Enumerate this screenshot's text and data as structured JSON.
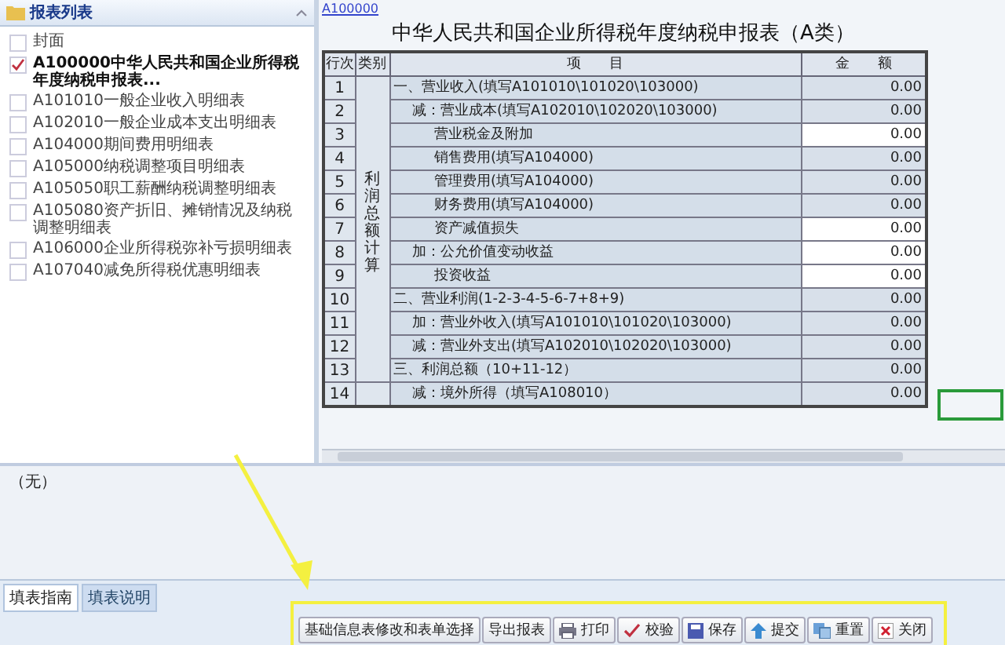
{
  "sidebar": {
    "title": "报表列表",
    "items": [
      {
        "label": "封面",
        "checked": false,
        "selected": false
      },
      {
        "label": "A100000中华人民共和国企业所得税年度纳税申报表...",
        "checked": true,
        "selected": true
      },
      {
        "label": "A101010一般企业收入明细表",
        "checked": false,
        "selected": false
      },
      {
        "label": "A102010一般企业成本支出明细表",
        "checked": false,
        "selected": false
      },
      {
        "label": "A104000期间费用明细表",
        "checked": false,
        "selected": false
      },
      {
        "label": "A105000纳税调整项目明细表",
        "checked": false,
        "selected": false
      },
      {
        "label": "A105050职工薪酬纳税调整明细表",
        "checked": false,
        "selected": false
      },
      {
        "label": "A105080资产折旧、摊销情况及纳税调整明细表",
        "checked": false,
        "selected": false
      },
      {
        "label": "A106000企业所得税弥补亏损明细表",
        "checked": false,
        "selected": false
      },
      {
        "label": "A107040减免所得税优惠明细表",
        "checked": false,
        "selected": false
      }
    ]
  },
  "form": {
    "link": "A100000",
    "title": "中华人民共和国企业所得税年度纳税申报表（A类）",
    "columns": [
      "行次",
      "类别",
      "项　　目",
      "金　　额"
    ],
    "category": "利润总额计算",
    "rows": [
      {
        "no": "1",
        "kind": "head",
        "item": "一、营业收入(填写A101010\\101020\\103000)",
        "amount": "0.00",
        "editable": false
      },
      {
        "no": "2",
        "kind": "sub",
        "item": "减：营业成本(填写A102010\\102020\\103000)",
        "amount": "0.00",
        "editable": false
      },
      {
        "no": "3",
        "kind": "detail",
        "item": "营业税金及附加",
        "amount": "0.00",
        "editable": true
      },
      {
        "no": "4",
        "kind": "detail",
        "item": "销售费用(填写A104000)",
        "amount": "0.00",
        "editable": false
      },
      {
        "no": "5",
        "kind": "detail",
        "item": "管理费用(填写A104000)",
        "amount": "0.00",
        "editable": false
      },
      {
        "no": "6",
        "kind": "detail",
        "item": "财务费用(填写A104000)",
        "amount": "0.00",
        "editable": false
      },
      {
        "no": "7",
        "kind": "detail",
        "item": "资产减值损失",
        "amount": "0.00",
        "editable": true
      },
      {
        "no": "8",
        "kind": "sub",
        "item": "加：公允价值变动收益",
        "amount": "0.00",
        "editable": true
      },
      {
        "no": "9",
        "kind": "detail",
        "item": "投资收益",
        "amount": "0.00",
        "editable": true
      },
      {
        "no": "10",
        "kind": "head",
        "item": "二、营业利润(1-2-3-4-5-6-7+8+9)",
        "amount": "0.00",
        "editable": false
      },
      {
        "no": "11",
        "kind": "sub",
        "item": "加：营业外收入(填写A101010\\101020\\103000)",
        "amount": "0.00",
        "editable": false
      },
      {
        "no": "12",
        "kind": "sub",
        "item": "减：营业外支出(填写A102010\\102020\\103000)",
        "amount": "0.00",
        "editable": false
      },
      {
        "no": "13",
        "kind": "head",
        "item": "三、利润总额（10+11-12）",
        "amount": "0.00",
        "editable": false
      },
      {
        "no": "14",
        "kind": "sub",
        "item": "减：境外所得（填写A108010）",
        "amount": "0.00",
        "editable": false
      }
    ]
  },
  "note": "（无）",
  "tabs": [
    {
      "label": "填表指南",
      "selected": true
    },
    {
      "label": "填表说明",
      "selected": false
    }
  ],
  "buttons": [
    {
      "label": "基础信息表修改和表单选择",
      "kind": "plain"
    },
    {
      "label": "导出报表",
      "kind": "plain"
    },
    {
      "label": "打印",
      "kind": "print"
    },
    {
      "label": "校验",
      "kind": "check"
    },
    {
      "label": "保存",
      "kind": "save"
    },
    {
      "label": "提交",
      "kind": "submit"
    },
    {
      "label": "重置",
      "kind": "reset"
    },
    {
      "label": "关闭",
      "kind": "close"
    }
  ]
}
